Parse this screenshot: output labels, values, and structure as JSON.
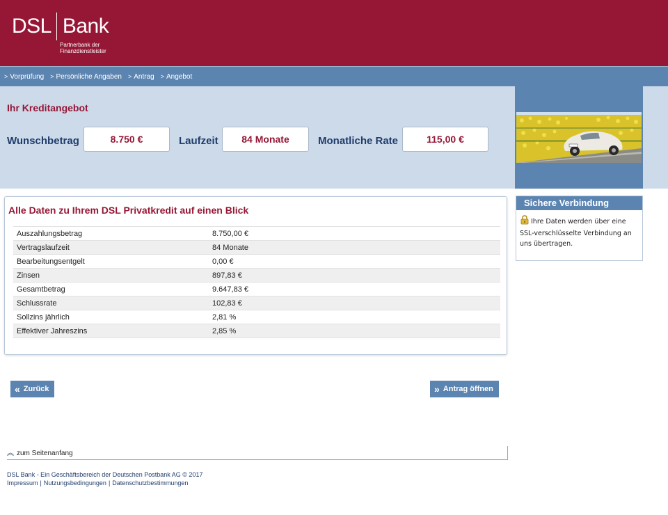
{
  "brand": {
    "name_left": "DSL",
    "name_right": "Bank",
    "tagline_line1": "Partnerbank der",
    "tagline_line2": "Finanzdienstleister",
    "color": "#951735"
  },
  "nav": [
    {
      "label": "Vorprüfung"
    },
    {
      "label": "Persönliche Angaben"
    },
    {
      "label": "Antrag"
    },
    {
      "label": "Angebot"
    }
  ],
  "offer": {
    "title": "Ihr Kreditangebot",
    "wunsch_label": "Wunschbetrag",
    "wunsch_value": "8.750 €",
    "laufzeit_label": "Laufzeit",
    "laufzeit_value": "84 Monate",
    "rate_label": "Monatliche Rate",
    "rate_value": "115,00 €"
  },
  "details": {
    "title": "Alle Daten zu Ihrem DSL Privatkredit auf einen Blick",
    "rows": [
      {
        "label": "Auszahlungsbetrag",
        "value": "8.750,00 €"
      },
      {
        "label": "Vertragslaufzeit",
        "value": "84 Monate"
      },
      {
        "label": "Bearbeitungsentgelt",
        "value": "0,00 €"
      },
      {
        "label": "Zinsen",
        "value": "897,83 €"
      },
      {
        "label": "Gesamtbetrag",
        "value": "9.647,83 €"
      },
      {
        "label": "Schlussrate",
        "value": "102,83 €"
      },
      {
        "label": "Sollzins jährlich",
        "value": "2,81 %"
      },
      {
        "label": "Effektiver Jahreszins",
        "value": "2,85 %"
      }
    ]
  },
  "buttons": {
    "back_label": "Zurück",
    "open_label": "Antrag öffnen"
  },
  "secure": {
    "title": "Sichere Verbindung",
    "text": "Ihre Daten werden über eine SSL-verschlüsselte Verbindung an uns übertragen."
  },
  "footer": {
    "top_link": "zum Seitenanfang",
    "copyright": "DSL Bank - Ein Geschäftsbereich der Deutschen Postbank AG © 2017",
    "links": [
      "Impressum",
      "Nutzungsbedingungen",
      "Datenschutzbestimmungen"
    ]
  }
}
